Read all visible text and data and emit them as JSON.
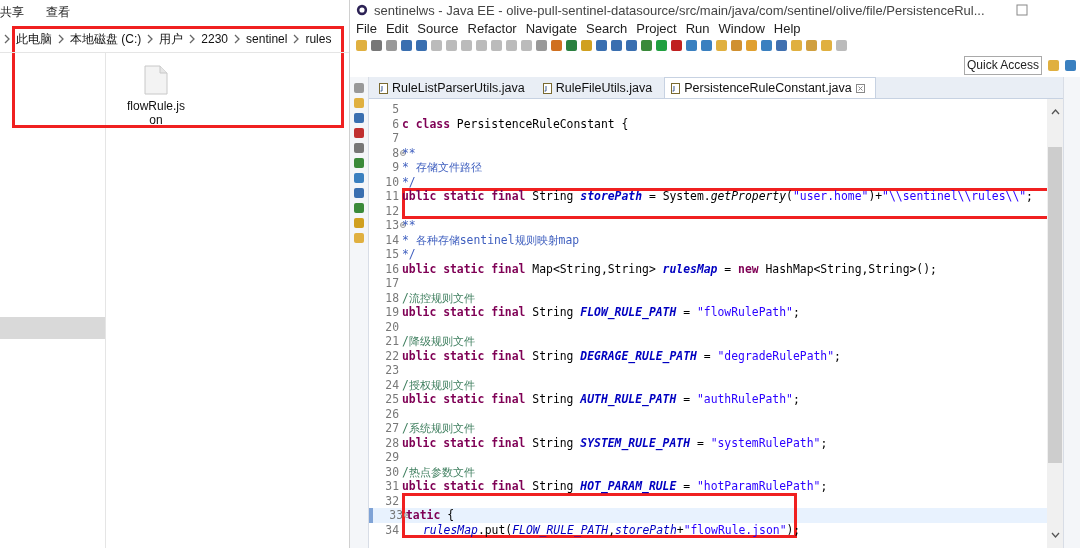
{
  "explorer": {
    "ribbon_tabs": [
      "共享",
      "查看"
    ],
    "breadcrumb": [
      "此电脑",
      "本地磁盘 (C:)",
      "用户",
      "2230",
      "sentinel",
      "rules"
    ],
    "highlighted": true,
    "nav_pane": {
      "has_selection": true
    },
    "files": [
      {
        "name": "flowRule.json"
      }
    ]
  },
  "eclipse": {
    "title": "sentinelws - Java EE - olive-pull-sentinel-datasource/src/main/java/com/sentinel/olive/file/PersistenceRul...",
    "menu": [
      "File",
      "Edit",
      "Source",
      "Refactor",
      "Navigate",
      "Search",
      "Project",
      "Run",
      "Window",
      "Help"
    ],
    "quick_access": {
      "placeholder": "Quick Access"
    },
    "tabs": [
      {
        "label": "RuleListParserUtils.java",
        "selected": false
      },
      {
        "label": "RuleFileUtils.java",
        "selected": false
      },
      {
        "label": "PersistenceRuleConstant.java",
        "selected": true
      }
    ],
    "lines": [
      {
        "number": "5"
      },
      {
        "number": "6",
        "tokens": [
          {
            "kind": "kw",
            "text": "c class"
          },
          {
            "kind": "plain",
            "text": " PersistenceRuleConstant {"
          }
        ]
      },
      {
        "number": "7"
      },
      {
        "number": "8",
        "fold": true,
        "tokens": [
          {
            "kind": "doc",
            "text": "**"
          }
        ]
      },
      {
        "number": "9",
        "tokens": [
          {
            "kind": "doc",
            "text": "* 存储文件路径"
          }
        ]
      },
      {
        "number": "10",
        "tokens": [
          {
            "kind": "doc",
            "text": "*/"
          }
        ]
      },
      {
        "number": "11",
        "highlight": true,
        "tokens": [
          {
            "kind": "kw",
            "text": "ublic static final"
          },
          {
            "kind": "plain",
            "text": " String "
          },
          {
            "kind": "field",
            "text": "storePath"
          },
          {
            "kind": "plain",
            "text": " = System."
          },
          {
            "kind": "method",
            "text": "getProperty"
          },
          {
            "kind": "plain",
            "text": "("
          },
          {
            "kind": "str",
            "text": "\"user.home\""
          },
          {
            "kind": "plain",
            "text": ")+"
          },
          {
            "kind": "str",
            "text": "\"\\\\sentinel\\\\rules\\\\\""
          },
          {
            "kind": "plain",
            "text": ";"
          }
        ]
      },
      {
        "number": "12",
        "highlight": true
      },
      {
        "number": "13",
        "fold": true,
        "tokens": [
          {
            "kind": "doc",
            "text": "**"
          }
        ]
      },
      {
        "number": "14",
        "tokens": [
          {
            "kind": "doc",
            "text": "* 各种存储sentinel规则映射map"
          }
        ]
      },
      {
        "number": "15",
        "tokens": [
          {
            "kind": "doc",
            "text": "*/"
          }
        ]
      },
      {
        "number": "16",
        "tokens": [
          {
            "kind": "kw",
            "text": "ublic static final"
          },
          {
            "kind": "plain",
            "text": " Map<String,String> "
          },
          {
            "kind": "field",
            "text": "rulesMap"
          },
          {
            "kind": "plain",
            "text": " = "
          },
          {
            "kind": "kw",
            "text": "new"
          },
          {
            "kind": "plain",
            "text": " HashMap<String,String>();"
          }
        ]
      },
      {
        "number": "17"
      },
      {
        "number": "18",
        "tokens": [
          {
            "kind": "comment",
            "text": "/流控规则文件"
          }
        ]
      },
      {
        "number": "19",
        "tokens": [
          {
            "kind": "kw",
            "text": "ublic static final"
          },
          {
            "kind": "plain",
            "text": " String "
          },
          {
            "kind": "field",
            "text": "FLOW_RULE_PATH"
          },
          {
            "kind": "plain",
            "text": " = "
          },
          {
            "kind": "str",
            "text": "\"flowRulePath\""
          },
          {
            "kind": "plain",
            "text": ";"
          }
        ]
      },
      {
        "number": "20"
      },
      {
        "number": "21",
        "tokens": [
          {
            "kind": "comment",
            "text": "/降级规则文件"
          }
        ]
      },
      {
        "number": "22",
        "tokens": [
          {
            "kind": "kw",
            "text": "ublic static final"
          },
          {
            "kind": "plain",
            "text": " String "
          },
          {
            "kind": "field",
            "text": "DEGRAGE_RULE_PATH"
          },
          {
            "kind": "plain",
            "text": " = "
          },
          {
            "kind": "str",
            "text": "\"degradeRulePath\""
          },
          {
            "kind": "plain",
            "text": ";"
          }
        ]
      },
      {
        "number": "23"
      },
      {
        "number": "24",
        "tokens": [
          {
            "kind": "comment",
            "text": "/授权规则文件"
          }
        ]
      },
      {
        "number": "25",
        "tokens": [
          {
            "kind": "kw",
            "text": "ublic static final"
          },
          {
            "kind": "plain",
            "text": " String "
          },
          {
            "kind": "field",
            "text": "AUTH_RULE_PATH"
          },
          {
            "kind": "plain",
            "text": " = "
          },
          {
            "kind": "str",
            "text": "\"authRulePath\""
          },
          {
            "kind": "plain",
            "text": ";"
          }
        ]
      },
      {
        "number": "26"
      },
      {
        "number": "27",
        "tokens": [
          {
            "kind": "comment",
            "text": "/系统规则文件"
          }
        ]
      },
      {
        "number": "28",
        "tokens": [
          {
            "kind": "kw",
            "text": "ublic static final"
          },
          {
            "kind": "plain",
            "text": " String "
          },
          {
            "kind": "field",
            "text": "SYSTEM_RULE_PATH"
          },
          {
            "kind": "plain",
            "text": " = "
          },
          {
            "kind": "str",
            "text": "\"systemRulePath\""
          },
          {
            "kind": "plain",
            "text": ";"
          }
        ]
      },
      {
        "number": "29"
      },
      {
        "number": "30",
        "tokens": [
          {
            "kind": "comment",
            "text": "/热点参数文件"
          }
        ]
      },
      {
        "number": "31",
        "tokens": [
          {
            "kind": "kw",
            "text": "ublic static final"
          },
          {
            "kind": "plain",
            "text": " String "
          },
          {
            "kind": "field",
            "text": "HOT_PARAM_RULE"
          },
          {
            "kind": "plain",
            "text": " = "
          },
          {
            "kind": "str",
            "text": "\"hotParamRulePath\""
          },
          {
            "kind": "plain",
            "text": ";"
          }
        ]
      },
      {
        "number": "32",
        "highlight": true
      },
      {
        "number": "33",
        "highlight": true,
        "fold": true,
        "current": true,
        "tokens": [
          {
            "kind": "kw",
            "text": "tatic"
          },
          {
            "kind": "plain",
            "text": " {"
          }
        ]
      },
      {
        "number": "34",
        "highlight": true,
        "indented": true,
        "tokens": [
          {
            "kind": "ref",
            "text": "rulesMap"
          },
          {
            "kind": "plain",
            "text": ".put("
          },
          {
            "kind": "ref",
            "text": "FLOW_RULE_PATH"
          },
          {
            "kind": "plain",
            "text": ","
          },
          {
            "kind": "ref",
            "text": "storePath"
          },
          {
            "kind": "plain",
            "text": "+"
          },
          {
            "kind": "str",
            "text": "\"flowRule.json\""
          },
          {
            "kind": "plain",
            "text": ");"
          }
        ]
      }
    ]
  }
}
